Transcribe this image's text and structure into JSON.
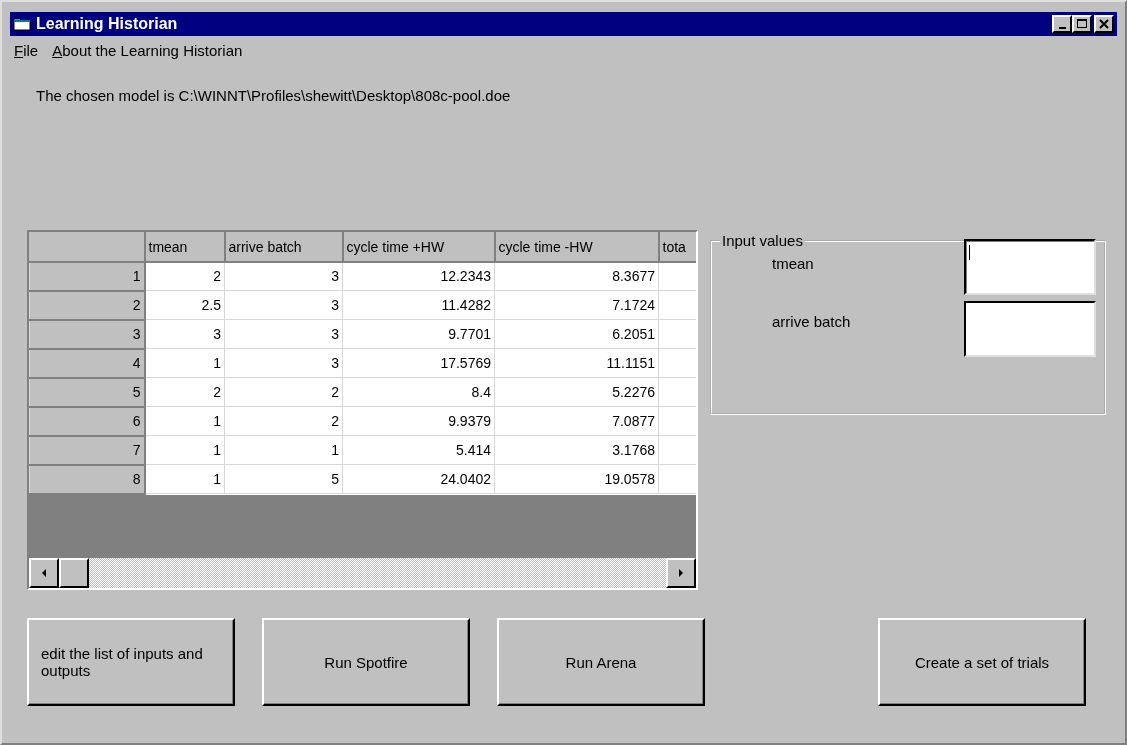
{
  "window": {
    "title": "Learning Historian"
  },
  "menu": [
    "File",
    "About the Learning Historian"
  ],
  "model_text": "The chosen model is C:\\WINNT\\Profiles\\shewitt\\Desktop\\808c-pool.doe",
  "table": {
    "columns": [
      "",
      "tmean",
      "arrive batch",
      "cycle time +HW",
      "cycle time -HW",
      "tota"
    ],
    "rows": [
      [
        "1",
        "2",
        "3",
        "12.2343",
        "8.3677",
        ""
      ],
      [
        "2",
        "2.5",
        "3",
        "11.4282",
        "7.1724",
        ""
      ],
      [
        "3",
        "3",
        "3",
        "9.7701",
        "6.2051",
        ""
      ],
      [
        "4",
        "1",
        "3",
        "17.5769",
        "11.1151",
        ""
      ],
      [
        "5",
        "2",
        "2",
        "8.4",
        "5.2276",
        ""
      ],
      [
        "6",
        "1",
        "2",
        "9.9379",
        "7.0877",
        ""
      ],
      [
        "7",
        "1",
        "1",
        "5.414",
        "3.1768",
        ""
      ],
      [
        "8",
        "1",
        "5",
        "24.0402",
        "19.0578",
        ""
      ]
    ]
  },
  "input_group": {
    "title": "Input values",
    "fields": [
      {
        "label": "tmean",
        "focused": true
      },
      {
        "label": "arrive batch",
        "focused": false
      }
    ]
  },
  "buttons": [
    "edit the list of inputs and outputs",
    "Run Spotfire",
    "Run Arena",
    "Create a set of trials"
  ]
}
